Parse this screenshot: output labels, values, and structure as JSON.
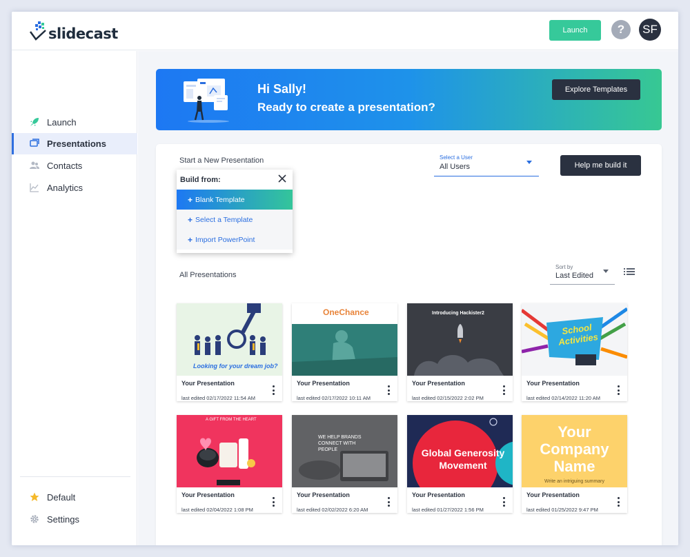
{
  "app": {
    "logo_text": "slidecast",
    "launch_button": "Launch",
    "help_icon": "?",
    "avatar_initials": "SF"
  },
  "sidebar": {
    "items": [
      {
        "label": "Launch",
        "icon": "rocket-icon",
        "active": false
      },
      {
        "label": "Presentations",
        "icon": "presentations-icon",
        "active": true
      },
      {
        "label": "Contacts",
        "icon": "contacts-icon",
        "active": false
      },
      {
        "label": "Analytics",
        "icon": "analytics-icon",
        "active": false
      }
    ],
    "bottom_items": [
      {
        "label": "Default",
        "icon": "star-icon"
      },
      {
        "label": "Settings",
        "icon": "gear-icon"
      }
    ]
  },
  "banner": {
    "greeting": "Hi Sally!",
    "subtitle": "Ready to create a presentation?",
    "button": "Explore Templates"
  },
  "new_presentation": {
    "label": "Start a New Presentation",
    "menu_title": "Build from:",
    "options": [
      "Blank Template",
      "Select a Template",
      "Import PowerPoint"
    ],
    "highlighted_option": "Blank Template"
  },
  "user_select": {
    "caption": "Select a User",
    "value": "All Users"
  },
  "help_build_button": "Help me build it",
  "presentations": {
    "label": "All Presentations",
    "sort_caption": "Sort by",
    "sort_value": "Last Edited",
    "items": [
      {
        "title": "Your Presentation",
        "date": "last edited 02/17/2022 11:54 AM",
        "thumb_text": "Looking for your dream job?"
      },
      {
        "title": "Your Presentation",
        "date": "last edited 02/17/2022 10:11 AM",
        "thumb_text": "OneChance"
      },
      {
        "title": "Your Presentation",
        "date": "last edited 02/15/2022 2:02 PM",
        "thumb_text": "Introducing Hackister2"
      },
      {
        "title": "Your Presentation",
        "date": "last edited 02/14/2022 11:20 AM",
        "thumb_text": "School Activities"
      },
      {
        "title": "Your Presentation",
        "date": "last edited 02/04/2022 1:08 PM",
        "thumb_text": "A GIFT FROM THE HEART"
      },
      {
        "title": "Your Presentation",
        "date": "last edited 02/02/2022 6:20 AM",
        "thumb_text": "WE HELP BRANDS CONNECT WITH PEOPLE"
      },
      {
        "title": "Your Presentation",
        "date": "last edited 01/27/2022 1:56 PM",
        "thumb_text": "Global Generosity Movement"
      },
      {
        "title": "Your Presentation",
        "date": "last edited 01/25/2022 9:47 PM",
        "thumb_text": "Your Company Name",
        "thumb_sub": "Write an intriguing summary"
      }
    ]
  },
  "colors": {
    "accent_green": "#36c99a",
    "accent_blue": "#2a6ee0",
    "dark_button": "#2a3140"
  }
}
